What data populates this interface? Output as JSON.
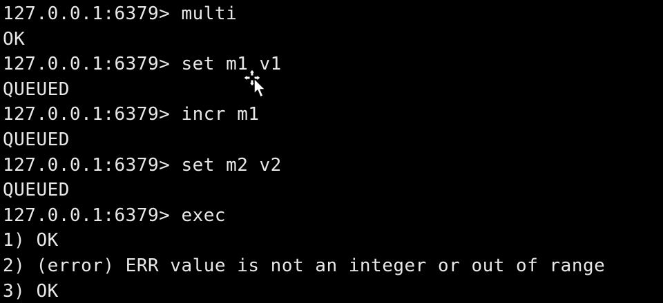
{
  "terminal": {
    "lines": [
      "127.0.0.1:6379> multi",
      "OK",
      "127.0.0.1:6379> set m1 v1",
      "QUEUED",
      "127.0.0.1:6379> incr m1",
      "QUEUED",
      "127.0.0.1:6379> set m2 v2",
      "QUEUED",
      "127.0.0.1:6379> exec",
      "1) OK",
      "2) (error) ERR value is not an integer or out of range",
      "3) OK"
    ]
  },
  "colors": {
    "background": "#000000",
    "text": "#e8e8e8"
  },
  "icons": {
    "cursor": "move-cursor-icon"
  }
}
